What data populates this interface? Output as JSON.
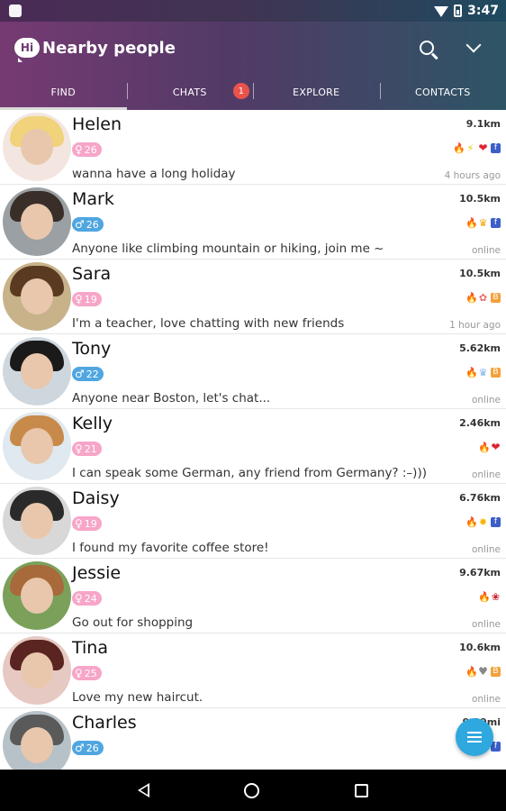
{
  "statusbar": {
    "time": "3:47"
  },
  "appbar": {
    "title": "Nearby people",
    "logo_text": "Hi",
    "search_icon": "search-icon",
    "more_icon": "chevron-down-icon"
  },
  "tabs": [
    {
      "label": "FIND",
      "active": true
    },
    {
      "label": "CHATS",
      "badge": "1"
    },
    {
      "label": "EXPLORE"
    },
    {
      "label": "CONTACTS"
    }
  ],
  "people": [
    {
      "name": "Helen",
      "distance": "9.1km",
      "gender": "female",
      "age": "26",
      "status": "wanna have a long holiday",
      "presence": "4 hours ago",
      "icons": [
        "fire-icon",
        "bolt-icon",
        "heart-icon",
        "facebook-icon"
      ]
    },
    {
      "name": "Mark",
      "distance": "10.5km",
      "gender": "male",
      "age": "26",
      "status": "Anyone like climbing mountain or hiking, join me ~",
      "presence": "online",
      "icons": [
        "fire-icon",
        "crown-icon",
        "facebook-icon"
      ]
    },
    {
      "name": "Sara",
      "distance": "10.5km",
      "gender": "female",
      "age": "19",
      "status": "I'm a teacher, love chatting with new friends",
      "presence": "1 hour ago",
      "icons": [
        "fire-icon",
        "flower-icon",
        "vip-icon"
      ]
    },
    {
      "name": "Tony",
      "distance": "5.62km",
      "gender": "male",
      "age": "22",
      "status": "Anyone near Boston, let's chat...",
      "presence": "online",
      "icons": [
        "fire-icon",
        "crown-blue-icon",
        "vip-icon"
      ]
    },
    {
      "name": "Kelly",
      "distance": "2.46km",
      "gender": "female",
      "age": "21",
      "status": "I can speak some German, any friend from Germany?   :–)))",
      "presence": "online",
      "icons": [
        "fire-icon",
        "heart-icon"
      ]
    },
    {
      "name": "Daisy",
      "distance": "6.76km",
      "gender": "female",
      "age": "19",
      "status": "I found my favorite coffee store!",
      "presence": "online",
      "icons": [
        "fire-icon",
        "star-icon",
        "facebook-icon"
      ]
    },
    {
      "name": "Jessie",
      "distance": "9.67km",
      "gender": "female",
      "age": "24",
      "status": "Go out for shopping",
      "presence": "online",
      "icons": [
        "fire-icon",
        "rose-icon"
      ]
    },
    {
      "name": "Tina",
      "distance": "10.6km",
      "gender": "female",
      "age": "25",
      "status": "Love my new haircut.",
      "presence": "online",
      "icons": [
        "fire-icon",
        "gray-heart-icon",
        "vip-icon"
      ]
    },
    {
      "name": "Charles",
      "distance": "9.09mi",
      "gender": "male",
      "age": "26",
      "status": "",
      "presence": "",
      "icons": [
        "facebook-icon"
      ]
    }
  ],
  "colors": {
    "female_badge": "#f7a5c9",
    "male_badge": "#4fa6e0",
    "fab": "#2fa7df",
    "badge_red": "#e9534b"
  },
  "fab_icon": "list-icon",
  "navbar": {
    "back": "back-icon",
    "home": "home-icon",
    "recent": "recent-apps-icon"
  }
}
